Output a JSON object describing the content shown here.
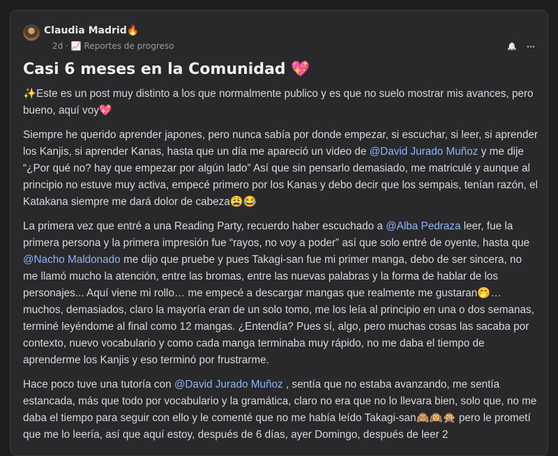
{
  "post": {
    "author": "Claudia Madrid",
    "author_emoji": "🔥",
    "time": "2d",
    "category_icon": "📈",
    "category": "Reportes de progreso",
    "title": "Casi 6 meses en la Comunidad",
    "title_emoji": "💖",
    "actions": {
      "bell_icon": "🔔",
      "more_icon": "⋯"
    },
    "p1": {
      "t1": "✨Este es un post muy distinto a los que normalmente publico y es que no suelo mostrar mis avances, pero bueno, aquí voy💖"
    },
    "p2": {
      "t1": "Siempre he querido aprender japones, pero nunca sabía por donde empezar, si escuchar, si leer, si aprender los Kanjis, si aprender Kanas, hasta que un día me apareció un video de ",
      "m1": "@David Jurado Muñoz",
      "t2": " y me dije “¿Por qué no? hay que empezar por algún lado” Así que sin pensarlo demasiado, me matriculé y aunque al principio no estuve muy activa, empecé primero por los Kanas y debo decir que los sempais, tenían razón, el Katakana siempre me dará dolor de cabeza😩😂"
    },
    "p3": {
      "t1": "La primera vez que entré a una Reading Party, recuerdo haber escuchado a ",
      "m1": "@Alba Pedraza",
      "t2": " leer, fue la primera persona y la primera impresión fue “rayos, no voy a poder” así que solo entré de oyente, hasta que ",
      "m2": "@Nacho Maldonado",
      "t3": " me dijo que pruebe y pues Takagi-san fue mi primer manga, debo de ser sincera, no me llamó mucho la atención, entre las bromas, entre las nuevas palabras y la forma de hablar de los personajes... Aquí viene mi rollo… me empecé a descargar mangas que realmente me gustaran🤭… muchos, demasiados, claro la mayoría eran de un solo tomo, me los leía al principio en una o dos semanas, terminé leyéndome al final como 12 mangas. ¿Entendía? Pues sí, algo, pero muchas cosas las sacaba por contexto, nuevo vocabulario y como cada manga terminaba muy rápido, no me daba el tiempo de aprenderme los Kanjis y eso terminó por frustrarme."
    },
    "p4": {
      "t1": "Hace poco tuve una tutoría con ",
      "m1": "@David Jurado Muñoz",
      "t2": " , sentía que no estaba avanzando, me sentía estancada, más que todo por vocabulario y la gramática, claro no era que no lo llevara bien, solo que, no me daba el tiempo para seguir con ello y le comenté que no me había leído Takagi-san🙈🙉🙊 pero le prometí que me lo leería, así que aquí estoy, después de 6 días, ayer Domingo, después de leer 2"
    }
  }
}
